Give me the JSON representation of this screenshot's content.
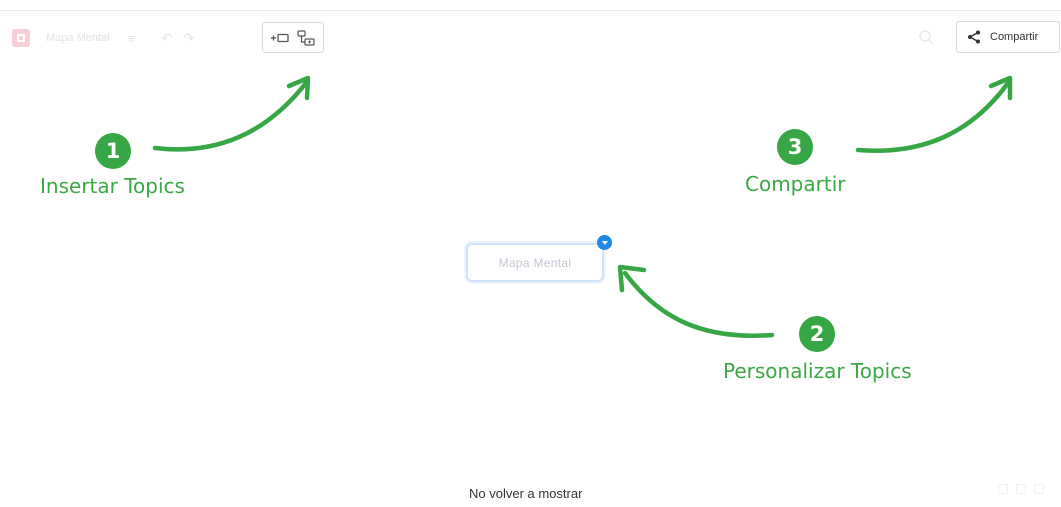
{
  "toolbar": {
    "document_title": "Mapa Mental",
    "share_label": "Compartir",
    "icons": {
      "app_logo": "mindmap-logo-icon",
      "menu": "hamburger-icon",
      "undo": "undo-icon",
      "redo": "redo-icon",
      "insert_topic": "insert-topic-icon",
      "insert_subtopic": "insert-subtopic-icon",
      "search": "search-icon",
      "share": "share-icon"
    }
  },
  "tutorial": {
    "steps": [
      {
        "number": "1",
        "label": "Insertar Topics"
      },
      {
        "number": "2",
        "label": "Personalizar Topics"
      },
      {
        "number": "3",
        "label": "Compartir"
      }
    ],
    "dismiss_label": "No volver a mostrar"
  },
  "canvas": {
    "central_topic": "Mapa Mental"
  },
  "colors": {
    "accent_green": "#36a744",
    "handle_blue": "#1e88e5",
    "logo_pink": "#e0446c"
  }
}
